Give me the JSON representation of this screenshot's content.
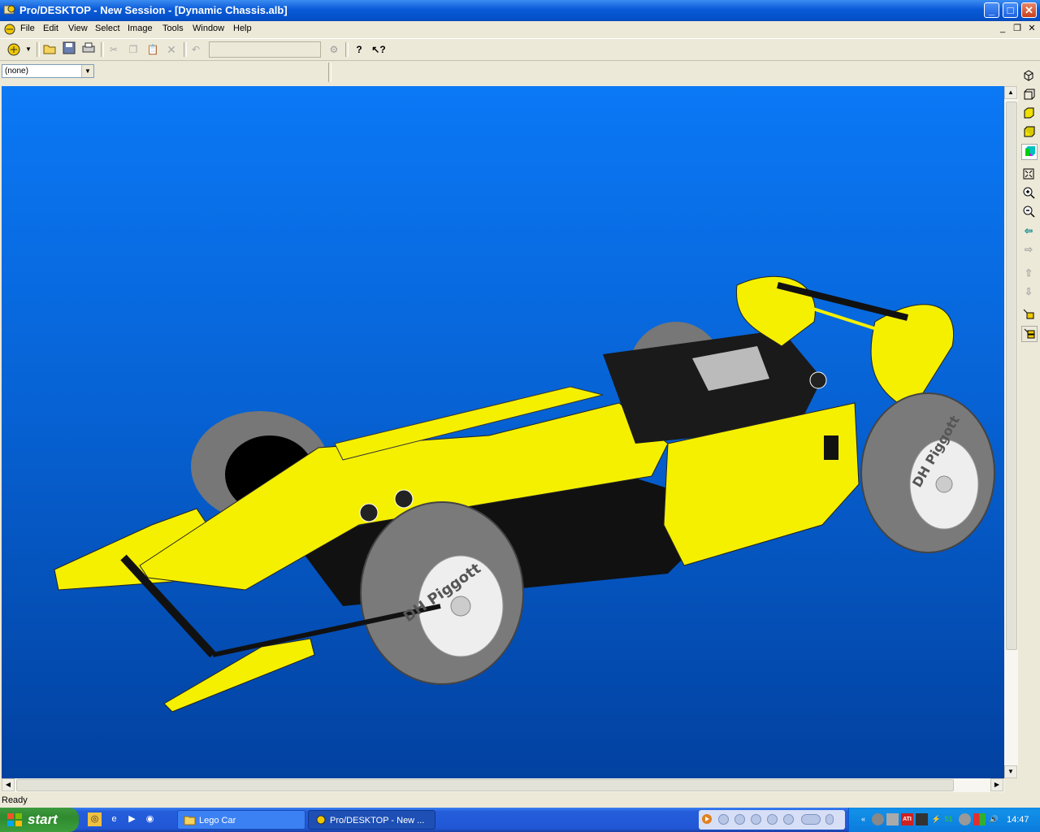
{
  "window": {
    "title": "Pro/DESKTOP - New Session - [Dynamic Chassis.alb]"
  },
  "caption_buttons": {
    "minimize": "_",
    "maximize": "□",
    "close": "✕"
  },
  "menu": {
    "items": [
      "File",
      "Edit",
      "View",
      "Select",
      "Image",
      "Tools",
      "Window",
      "Help"
    ]
  },
  "mdi_buttons": {
    "minimize": "_",
    "restore": "❐",
    "close": "✕"
  },
  "toolbar": {
    "icons": [
      "workplane-select-icon",
      "open-folder-icon",
      "save-icon",
      "print-icon",
      "cut-icon",
      "copy-icon",
      "paste-icon",
      "delete-icon",
      "undo-icon",
      "redo-icon",
      "help-icon",
      "context-help-icon"
    ]
  },
  "combo": {
    "value": "(none)"
  },
  "viewport": {
    "model_text": "DH Piggott"
  },
  "right_toolbar": {
    "icons": [
      "isometric-view-icon",
      "wireframe-view-icon",
      "shaded-view-icon",
      "solid-view-icon",
      "color-view-icon",
      "zoom-fit-icon",
      "zoom-in-icon",
      "zoom-out-icon",
      "pan-left-icon",
      "pan-right-icon",
      "pan-up-icon",
      "pan-down-icon",
      "render-icon",
      "multi-render-icon"
    ]
  },
  "status": {
    "text": "Ready"
  },
  "taskbar": {
    "start_label": "start",
    "tasks": [
      {
        "label": "Lego Car"
      },
      {
        "label": "Pro/DESKTOP - New ..."
      }
    ],
    "clock": "14:47",
    "tray_text": "51"
  }
}
